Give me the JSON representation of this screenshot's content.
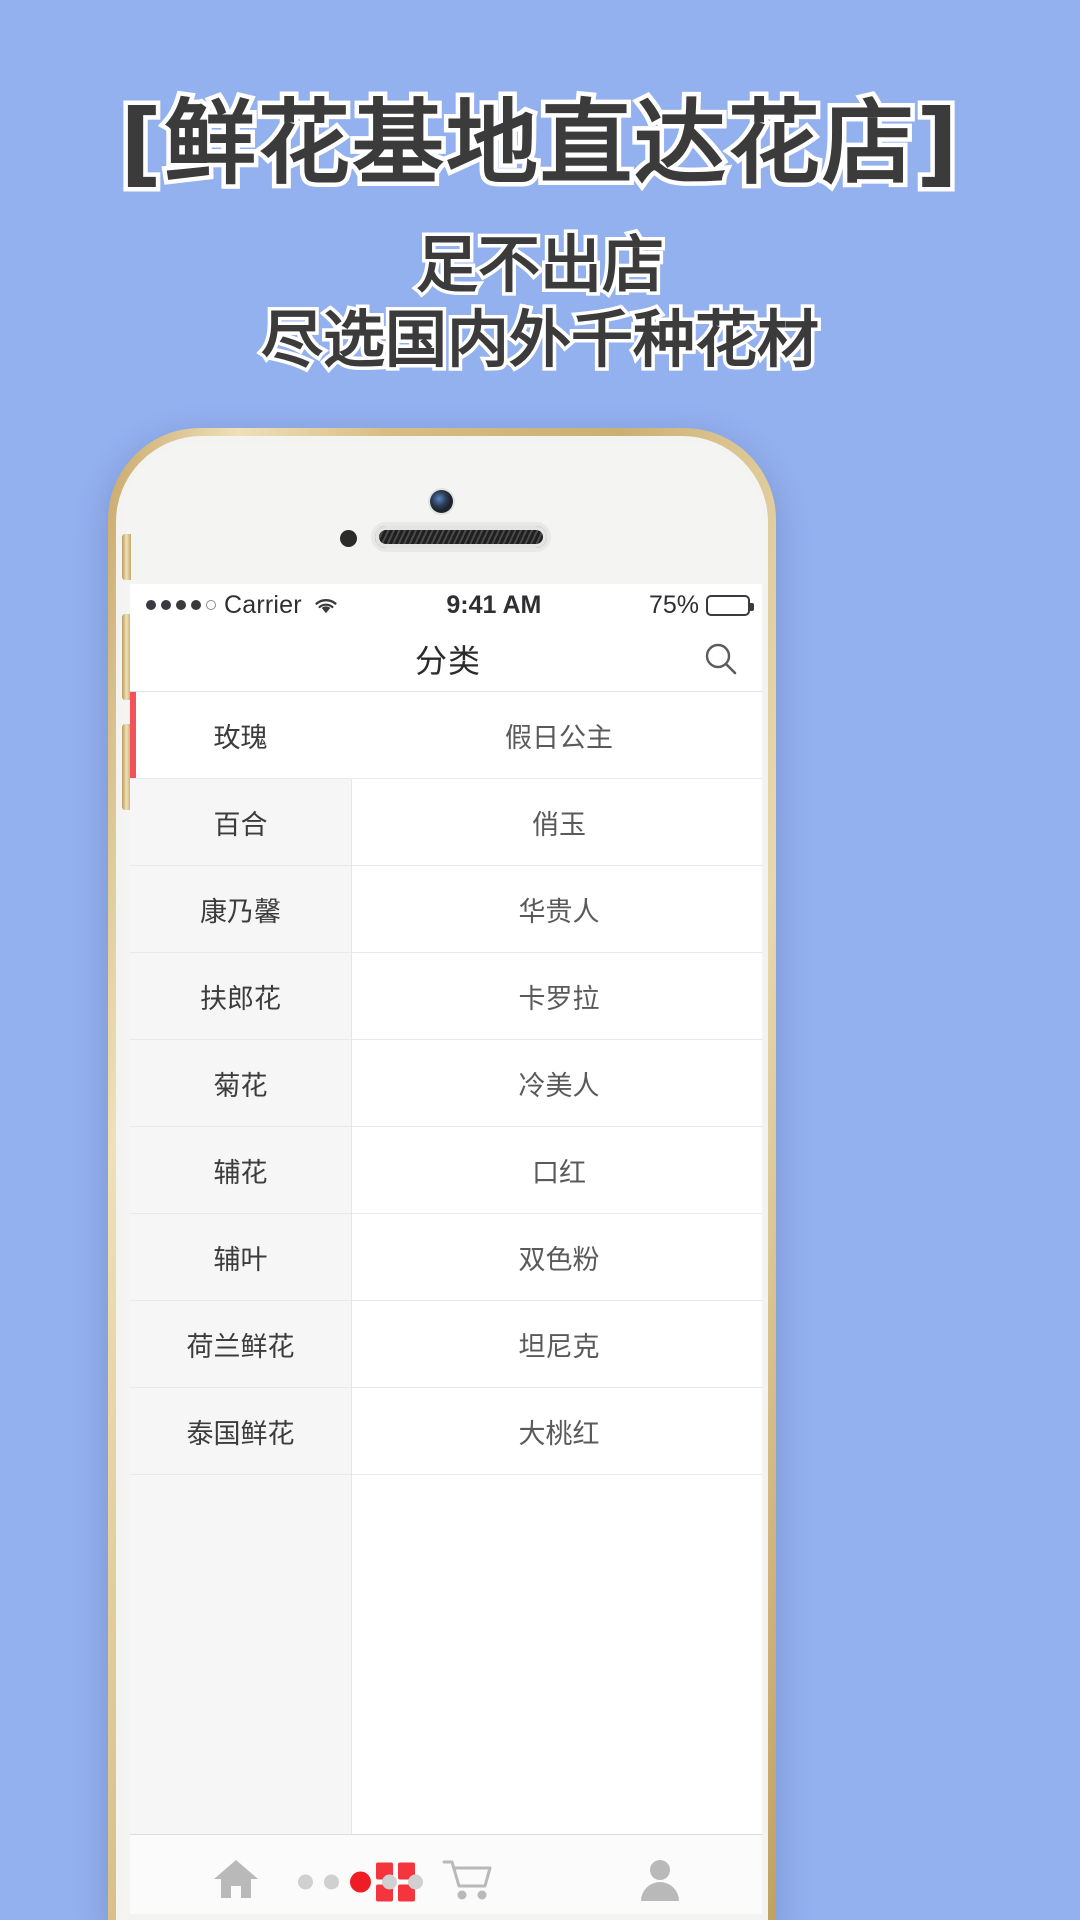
{
  "promo": {
    "headline": "[鲜花基地直达花店]",
    "sub_line1": "足不出店",
    "sub_line2": "尽选国内外千种花材",
    "bg_color": "#93b0ef",
    "text_color": "#3b3b3b",
    "outline_color": "#ffffff"
  },
  "status_bar": {
    "carrier": "Carrier",
    "time": "9:41 AM",
    "battery_percent": "75%",
    "battery_level": 75,
    "signal_dots_filled": 4,
    "signal_dots_total": 5,
    "wifi_icon": "wifi-icon"
  },
  "nav": {
    "title": "分类",
    "search_icon": "search-icon"
  },
  "categories": [
    {
      "name": "玫瑰",
      "active": true
    },
    {
      "name": "百合",
      "active": false
    },
    {
      "name": "康乃馨",
      "active": false
    },
    {
      "name": "扶郎花",
      "active": false
    },
    {
      "name": "菊花",
      "active": false
    },
    {
      "name": "辅花",
      "active": false
    },
    {
      "name": "辅叶",
      "active": false
    },
    {
      "name": "荷兰鲜花",
      "active": false
    },
    {
      "name": "泰国鲜花",
      "active": false
    }
  ],
  "varieties": [
    {
      "name": "假日公主"
    },
    {
      "name": "俏玉"
    },
    {
      "name": "华贵人"
    },
    {
      "name": "卡罗拉"
    },
    {
      "name": "冷美人"
    },
    {
      "name": "口红"
    },
    {
      "name": "双色粉"
    },
    {
      "name": "坦尼克"
    },
    {
      "name": "大桃红"
    }
  ],
  "tabbar": {
    "items": [
      {
        "icon": "home-icon",
        "label": ""
      },
      {
        "icon": "grid-icon",
        "label": ""
      },
      {
        "icon": "cart-icon",
        "label": ""
      },
      {
        "icon": "person-icon",
        "label": ""
      }
    ],
    "accent_color": "#ee1c25",
    "icon_color": "#b9b9b9"
  },
  "theme": {
    "active_indicator": "#f4525a",
    "list_bg_left": "#f6f6f6",
    "list_bg_right": "#ffffff"
  }
}
